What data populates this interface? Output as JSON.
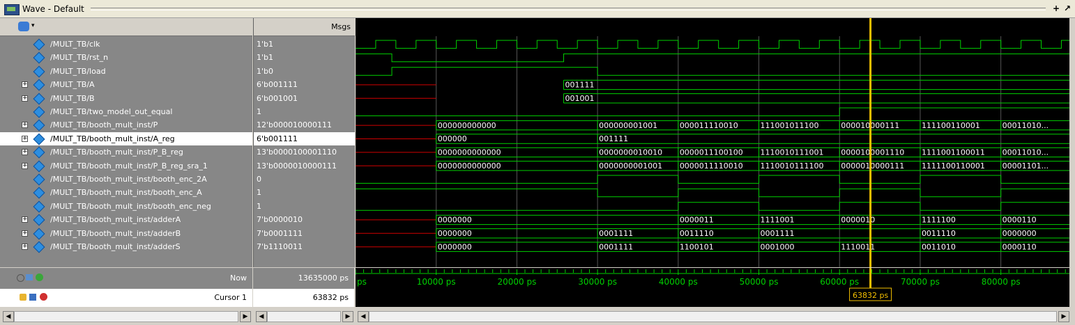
{
  "window": {
    "title": "Wave - Default"
  },
  "columns": {
    "msgs_label": "Msgs"
  },
  "signals": [
    {
      "name": "/MULT_TB/clk",
      "value": "1'b1",
      "expandable": false,
      "selected": false
    },
    {
      "name": "/MULT_TB/rst_n",
      "value": "1'b1",
      "expandable": false,
      "selected": false
    },
    {
      "name": "/MULT_TB/load",
      "value": "1'b0",
      "expandable": false,
      "selected": false
    },
    {
      "name": "/MULT_TB/A",
      "value": "6'b001111",
      "expandable": true,
      "selected": false
    },
    {
      "name": "/MULT_TB/B",
      "value": "6'b001001",
      "expandable": true,
      "selected": false
    },
    {
      "name": "/MULT_TB/two_model_out_equal",
      "value": "1",
      "expandable": false,
      "selected": false
    },
    {
      "name": "/MULT_TB/booth_mult_inst/P",
      "value": "12'b000010000111",
      "expandable": true,
      "selected": false
    },
    {
      "name": "/MULT_TB/booth_mult_inst/A_reg",
      "value": "6'b001111",
      "expandable": true,
      "selected": true
    },
    {
      "name": "/MULT_TB/booth_mult_inst/P_B_reg",
      "value": "13'b0000100001110",
      "expandable": true,
      "selected": false
    },
    {
      "name": "/MULT_TB/booth_mult_inst/P_B_reg_sra_1",
      "value": "13'b0000010000111",
      "expandable": true,
      "selected": false
    },
    {
      "name": "/MULT_TB/booth_mult_inst/booth_enc_2A",
      "value": "0",
      "expandable": false,
      "selected": false
    },
    {
      "name": "/MULT_TB/booth_mult_inst/booth_enc_A",
      "value": "1",
      "expandable": false,
      "selected": false
    },
    {
      "name": "/MULT_TB/booth_mult_inst/booth_enc_neg",
      "value": "1",
      "expandable": false,
      "selected": false
    },
    {
      "name": "/MULT_TB/booth_mult_inst/adderA",
      "value": "7'b0000010",
      "expandable": true,
      "selected": false
    },
    {
      "name": "/MULT_TB/booth_mult_inst/adderB",
      "value": "7'b0001111",
      "expandable": true,
      "selected": false
    },
    {
      "name": "/MULT_TB/booth_mult_inst/adderS",
      "value": "7'b1110011",
      "expandable": true,
      "selected": false
    }
  ],
  "bus_values": [
    {
      "row": 3,
      "segs": [
        {
          "t": 25800,
          "label": "001111"
        }
      ]
    },
    {
      "row": 4,
      "segs": [
        {
          "t": 25800,
          "label": "001001"
        }
      ]
    },
    {
      "row": 6,
      "segs": [
        {
          "t": 10000,
          "label": "000000000000"
        },
        {
          "t": 30000,
          "label": "000000001001"
        },
        {
          "t": 40000,
          "label": "000011110010"
        },
        {
          "t": 50000,
          "label": "111001011100"
        },
        {
          "t": 60000,
          "label": "000010000111"
        },
        {
          "t": 70000,
          "label": "111100110001"
        },
        {
          "t": 80000,
          "label": "00011010..."
        }
      ]
    },
    {
      "row": 7,
      "segs": [
        {
          "t": 10000,
          "label": "000000"
        },
        {
          "t": 30000,
          "label": "001111"
        }
      ]
    },
    {
      "row": 8,
      "segs": [
        {
          "t": 10000,
          "label": "0000000000000"
        },
        {
          "t": 30000,
          "label": "0000000010010"
        },
        {
          "t": 40000,
          "label": "0000011100100"
        },
        {
          "t": 50000,
          "label": "1110010111001"
        },
        {
          "t": 60000,
          "label": "0000100001110"
        },
        {
          "t": 70000,
          "label": "1111001100011"
        },
        {
          "t": 80000,
          "label": "00011010..."
        }
      ]
    },
    {
      "row": 9,
      "segs": [
        {
          "t": 10000,
          "label": "0000000000000"
        },
        {
          "t": 30000,
          "label": "0000000001001"
        },
        {
          "t": 40000,
          "label": "0000011110010"
        },
        {
          "t": 50000,
          "label": "1110010111100"
        },
        {
          "t": 60000,
          "label": "0000010000111"
        },
        {
          "t": 70000,
          "label": "1111100110001"
        },
        {
          "t": 80000,
          "label": "00001101..."
        }
      ]
    },
    {
      "row": 13,
      "segs": [
        {
          "t": 10000,
          "label": "0000000"
        },
        {
          "t": 40000,
          "label": "0000011"
        },
        {
          "t": 50000,
          "label": "1111001"
        },
        {
          "t": 60000,
          "label": "0000010"
        },
        {
          "t": 70000,
          "label": "1111100"
        },
        {
          "t": 80000,
          "label": "0000110"
        }
      ]
    },
    {
      "row": 14,
      "segs": [
        {
          "t": 10000,
          "label": "0000000"
        },
        {
          "t": 30000,
          "label": "0001111"
        },
        {
          "t": 40000,
          "label": "0011110"
        },
        {
          "t": 50000,
          "label": "0001111"
        },
        {
          "t": 70000,
          "label": "0011110"
        },
        {
          "t": 80000,
          "label": "0000000"
        }
      ]
    },
    {
      "row": 15,
      "segs": [
        {
          "t": 10000,
          "label": "0000000"
        },
        {
          "t": 30000,
          "label": "0001111"
        },
        {
          "t": 40000,
          "label": "1100101"
        },
        {
          "t": 50000,
          "label": "0001000"
        },
        {
          "t": 60000,
          "label": "1110011"
        },
        {
          "t": 70000,
          "label": "0011010"
        },
        {
          "t": 80000,
          "label": "0000110"
        }
      ]
    }
  ],
  "timeline": {
    "tick_labels": [
      "ps",
      "10000 ps",
      "20000 ps",
      "30000 ps",
      "40000 ps",
      "50000 ps",
      "60000 ps",
      "70000 ps",
      "80000 ps"
    ],
    "tick_times": [
      0,
      10000,
      20000,
      30000,
      40000,
      50000,
      60000,
      70000,
      80000
    ],
    "view_start_ps": 0,
    "view_end_ps": 88500
  },
  "now": {
    "label": "Now",
    "value": "13635000 ps"
  },
  "cursor": {
    "label": "Cursor 1",
    "value": "63832 ps",
    "time_ps": 63832,
    "marker_label": "63832 ps"
  },
  "colors": {
    "wave": "#00d000",
    "cursor": "#f5c000",
    "undefined": "#d00000",
    "selected_row": "#ffffff"
  }
}
